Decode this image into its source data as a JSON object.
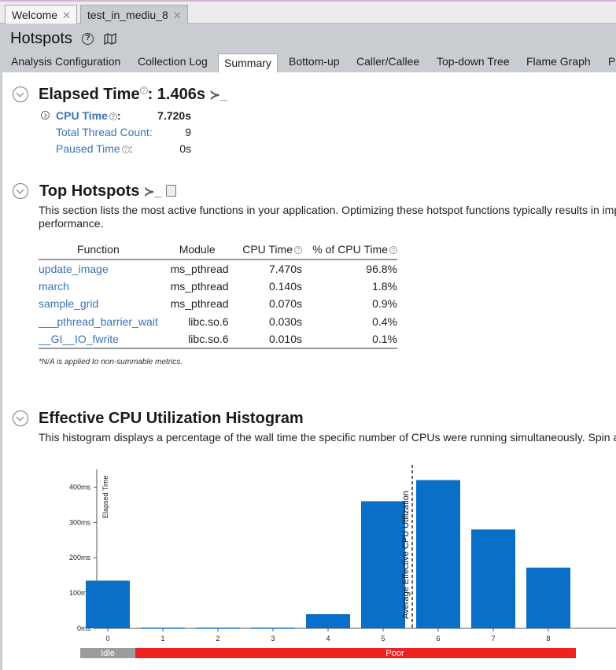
{
  "tabs": [
    {
      "label": "Welcome",
      "active": false
    },
    {
      "label": "test_in_mediu_8",
      "active": true
    }
  ],
  "header": {
    "title": "Hotspots",
    "view_tabs": [
      "Analysis Configuration",
      "Collection Log",
      "Summary",
      "Bottom-up",
      "Caller/Callee",
      "Top-down Tree",
      "Flame Graph",
      "P"
    ],
    "active_tab": "Summary"
  },
  "elapsed": {
    "title": "Elapsed Time",
    "value": ": 1.406s",
    "metrics": [
      {
        "label": "CPU Time",
        "value": "7.720s"
      },
      {
        "label": "Total Thread Count:",
        "value": "9"
      },
      {
        "label": "Paused Time",
        "value": "0s"
      }
    ]
  },
  "hotspots": {
    "title": "Top Hotspots",
    "description_line1": "This section lists the most active functions in your application. Optimizing these hotspot functions typically results in imp",
    "description_line2": "performance.",
    "columns": [
      "Function",
      "Module",
      "CPU Time",
      "% of CPU Time"
    ],
    "rows": [
      {
        "function": "update_image",
        "module": "ms_pthread",
        "cpu_time": "7.470s",
        "pct": "96.8%"
      },
      {
        "function": "march",
        "module": "ms_pthread",
        "cpu_time": "0.140s",
        "pct": "1.8%"
      },
      {
        "function": "sample_grid",
        "module": "ms_pthread",
        "cpu_time": "0.070s",
        "pct": "0.9%"
      },
      {
        "function": "___pthread_barrier_wait",
        "module": "libc.so.6",
        "cpu_time": "0.030s",
        "pct": "0.4%"
      },
      {
        "function": "__GI__IO_fwrite",
        "module": "libc.so.6",
        "cpu_time": "0.010s",
        "pct": "0.1%"
      }
    ],
    "footnote": "*N/A is applied to non-summable metrics."
  },
  "histogram": {
    "title": "Effective CPU Utilization Histogram",
    "description": "This histogram displays a percentage of the wall time the specific number of CPUs were running simultaneously. Spin a"
  },
  "chart_data": {
    "type": "bar",
    "categories": [
      "0",
      "1",
      "2",
      "3",
      "4",
      "5",
      "6",
      "7",
      "8"
    ],
    "values": [
      135,
      2,
      2,
      2,
      40,
      360,
      420,
      280,
      172
    ],
    "ylabel": "Elapsed Time",
    "yticks": [
      "0ms",
      "100ms",
      "200ms",
      "300ms",
      "400ms"
    ],
    "ylim": [
      0,
      450
    ],
    "average_marker_label": "Average Effective CPU Utilization",
    "average_marker_x": 5.8,
    "bar_color": "#0a6fc7",
    "zones": [
      {
        "label": "Idle",
        "color": "#9c9c9c",
        "from": -0.5,
        "to": 0.5
      },
      {
        "label": "Poor",
        "color": "#ee2222",
        "from": 0.5,
        "to": 8.5
      }
    ]
  }
}
